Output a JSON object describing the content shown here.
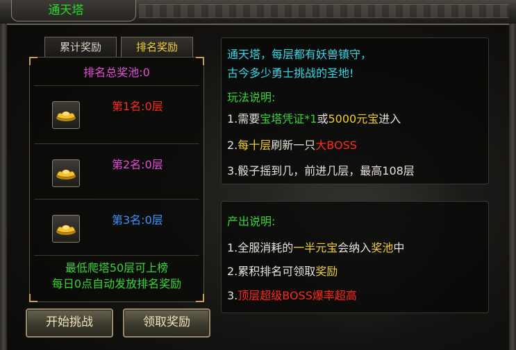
{
  "window": {
    "title": "通天塔"
  },
  "tabs": [
    {
      "label": "累计奖励",
      "active": false
    },
    {
      "label": "排名奖励",
      "active": true
    }
  ],
  "ranking": {
    "pool_label": "排名总奖池:0",
    "ranks": [
      {
        "label": "第1名:0层",
        "color": "#ff2a1f",
        "reward_icon": "gold-ingot-icon"
      },
      {
        "label": "第2名:0层",
        "color": "#e64ddc",
        "reward_icon": "gold-ingot-icon"
      },
      {
        "label": "第3名:0层",
        "color": "#3c94ff",
        "reward_icon": "gold-ingot-icon"
      }
    ],
    "notes": [
      "最低爬塔50层可上榜",
      "每日0点自动发放排名奖励"
    ]
  },
  "buttons": {
    "start": "开始挑战",
    "claim": "领取奖励"
  },
  "intro": {
    "lines": [
      "通天塔，每层都有妖兽镇守，",
      "古今多少勇士挑战的圣地!"
    ],
    "rules_title": "玩法说明:",
    "rule1": {
      "prefix": "1.需要",
      "item": "宝塔凭证*1",
      "or": "或",
      "amount": "5000元宝",
      "suffix": "进入"
    },
    "rule2": {
      "prefix": "2.",
      "highlight": "每十层",
      "middle": "刷新一只",
      "boss": "大BOSS"
    },
    "rule3": "3.骰子摇到几，前进几层，最高108层"
  },
  "output": {
    "title": "产出说明:",
    "item1": {
      "prefix": "1.全服消耗的",
      "highlight": "一半元宝",
      "middle": "会纳入",
      "pool": "奖池",
      "suffix": "中"
    },
    "item2": {
      "prefix": "2.累积排名可领取",
      "highlight": "奖励"
    },
    "item3": {
      "prefix": "3.",
      "text": "顶层超级BOSS爆率超高"
    }
  },
  "colors": {
    "title_green": "#2dd62d",
    "cyan": "#34d8e6",
    "green": "#35d835",
    "yellow": "#f3d131",
    "red": "#ff2a1f",
    "magenta": "#e64ddc",
    "blue": "#3c94ff"
  }
}
